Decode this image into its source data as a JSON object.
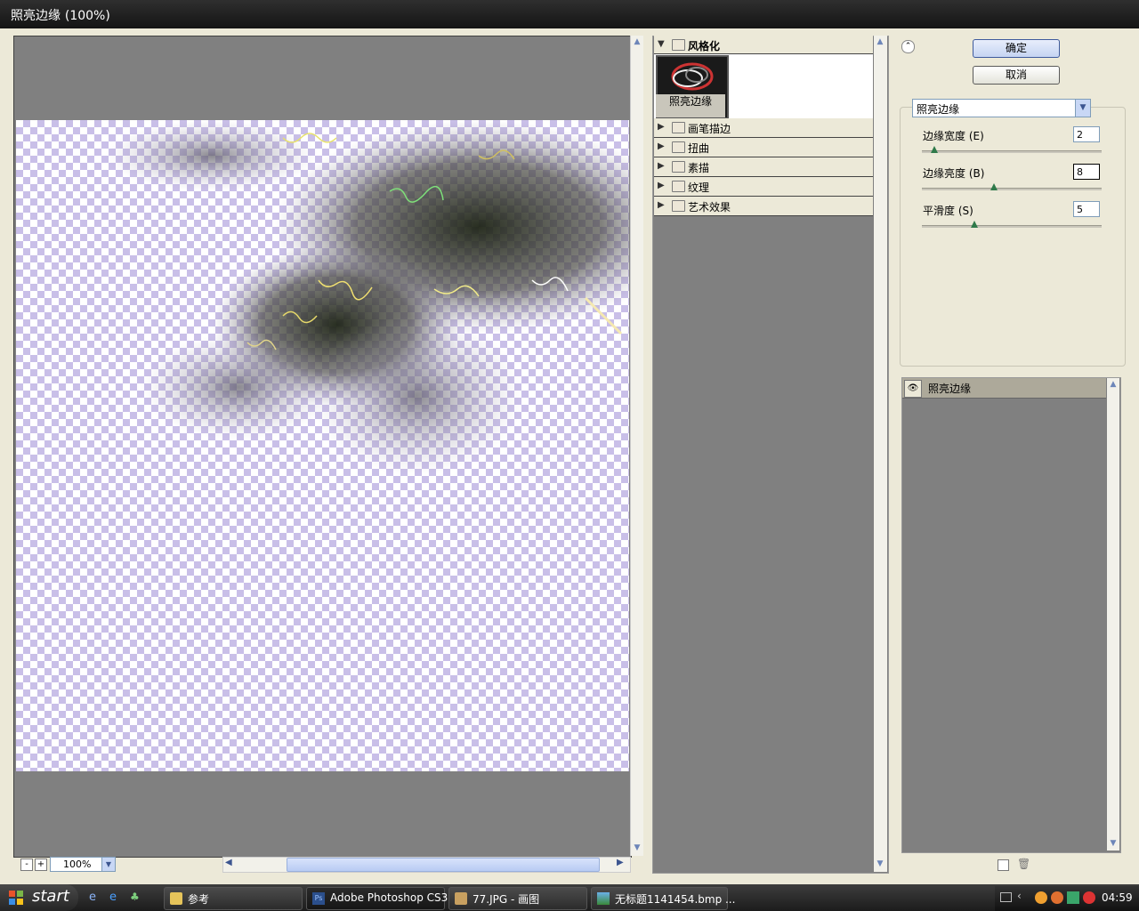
{
  "window": {
    "title": "照亮边缘",
    "zoom_suffix": "(100%)"
  },
  "preview": {
    "zoom_value": "100%",
    "zoom_out": "-",
    "zoom_in": "+"
  },
  "gallery": {
    "expanded_category": "风格化",
    "selected_filter": "照亮边缘",
    "categories": [
      "画笔描边",
      "扭曲",
      "素描",
      "纹理",
      "艺术效果"
    ]
  },
  "buttons": {
    "ok": "确定",
    "cancel": "取消"
  },
  "filter_select": {
    "value": "照亮边缘"
  },
  "params": [
    {
      "label": "边缘宽度 (E)",
      "value": "2",
      "level": 0.07
    },
    {
      "label": "边缘亮度 (B)",
      "value": "8",
      "level": 0.4
    },
    {
      "label": "平滑度 (S)",
      "value": "5",
      "level": 0.29
    }
  ],
  "layers": [
    {
      "name": "照亮边缘"
    }
  ],
  "taskbar": {
    "start_label": "start",
    "tasks": [
      "参考",
      "Adobe Photoshop CS3",
      "77.JPG - 画图",
      "无标题1141454.bmp ..."
    ],
    "clock": "04:59"
  }
}
